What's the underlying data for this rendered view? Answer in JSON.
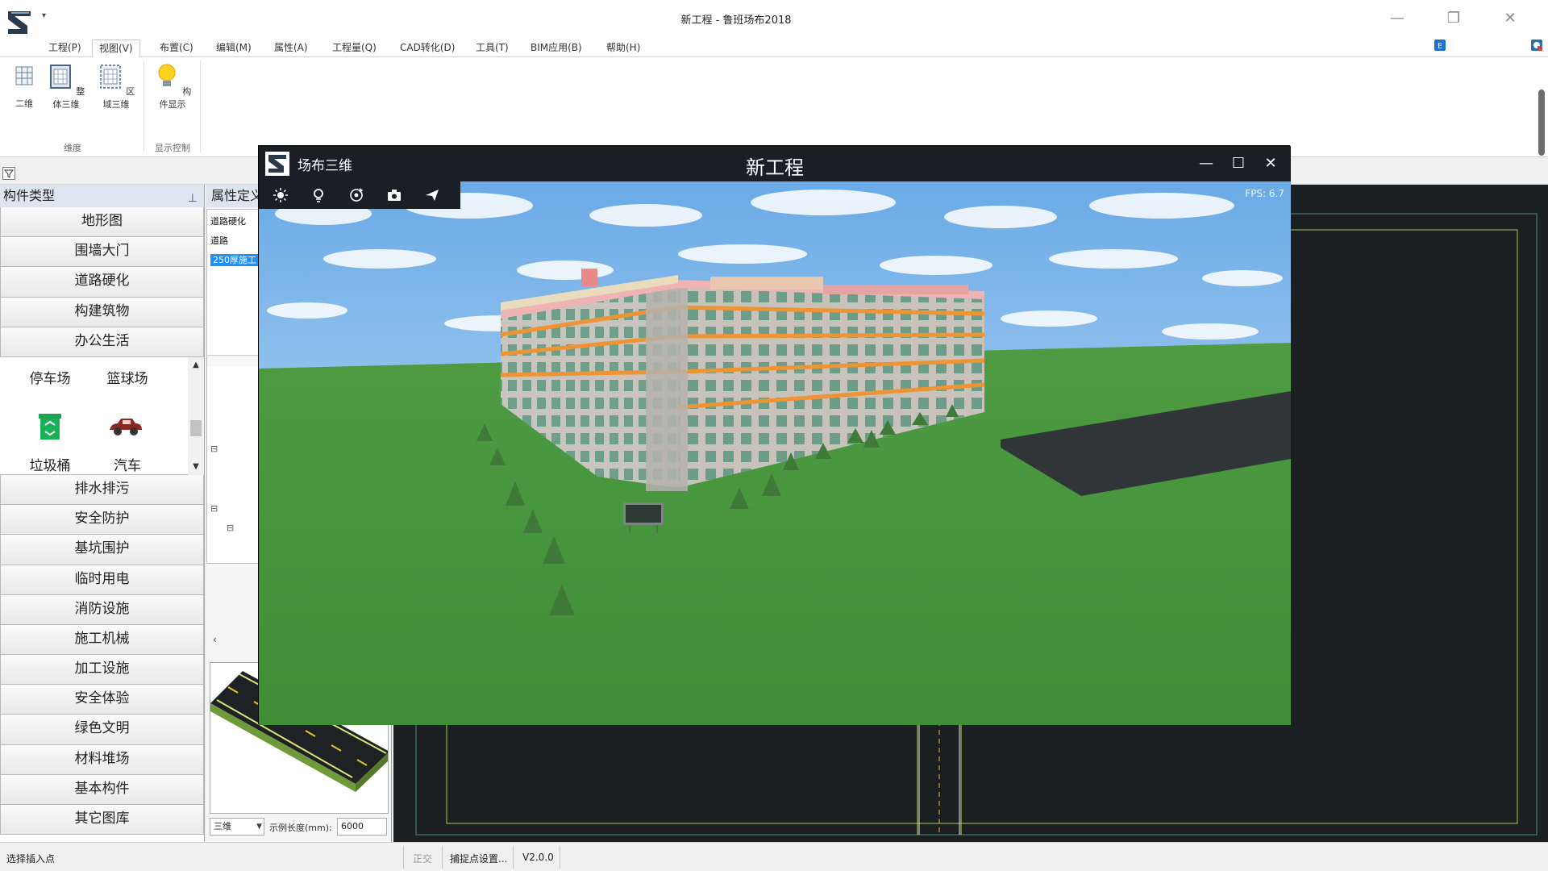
{
  "app": {
    "title": "新工程 - 鲁班场布2018"
  },
  "menu": {
    "items": [
      "工程(P)",
      "视图(V)",
      "布置(C)",
      "编辑(M)",
      "属性(A)",
      "工程量(Q)",
      "CAD转化(D)",
      "工具(T)",
      "BIM应用(B)",
      "帮助(H)"
    ],
    "active": "视图(V)"
  },
  "ribbon": {
    "buttons": [
      "二维",
      "整体三维",
      "区域三维",
      "构件显示"
    ],
    "groups": [
      "维度",
      "显示控制"
    ]
  },
  "left_panel": {
    "title": "构件类型",
    "categories_top": [
      "地形图",
      "围墙大门",
      "道路硬化",
      "构建筑物",
      "办公生活"
    ],
    "library_items": [
      "停车场",
      "篮球场",
      "垃圾桶",
      "汽车"
    ],
    "categories_bottom": [
      "排水排污",
      "安全防护",
      "基坑围护",
      "临时用电",
      "消防设施",
      "施工机械",
      "加工设施",
      "安全体验",
      "绿色文明",
      "材料堆场",
      "基本构件",
      "其它图库"
    ]
  },
  "prop_panel": {
    "title": "属性定义",
    "tree": [
      "道路硬化",
      "道路",
      "250厚施工"
    ],
    "view_mode": "三维",
    "length_label": "示例长度(mm):",
    "length_value": "6000"
  },
  "viewer": {
    "name": "场布三维",
    "title": "新工程",
    "fps": "FPS: 6.7"
  },
  "status": {
    "prompt": "选择插入点",
    "ortho": "正交",
    "snap": "捕捉点设置...",
    "version": "V2.0.0"
  },
  "colors": {
    "accent": "#1e90ff",
    "viewer_bg": "#1a1f26",
    "cad_bg": "#1c1f22",
    "grass": "#4b9a3e",
    "sky": "#8fc0ee"
  }
}
